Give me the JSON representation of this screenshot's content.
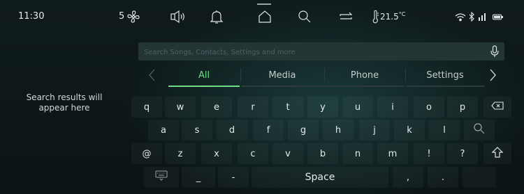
{
  "status_bar": {
    "time": "11:30",
    "fan_speed": "5",
    "temperature": "21.5",
    "temperature_unit": "°C",
    "icons": [
      "fan-icon",
      "volume-icon",
      "bell-icon",
      "home-icon",
      "search-icon",
      "repeat-icon",
      "thermometer-icon",
      "wifi-icon",
      "bluetooth-icon",
      "signal-icon",
      "battery-icon"
    ]
  },
  "search": {
    "placeholder": "Search Songs, Contacts, Settings and more",
    "value": "",
    "mic_icon": "microphone-icon"
  },
  "tabs": {
    "items": [
      {
        "label": "All",
        "active": true
      },
      {
        "label": "Media",
        "active": false
      },
      {
        "label": "Phone",
        "active": false
      },
      {
        "label": "Settings",
        "active": false
      }
    ],
    "accent_color": "#6fdc86"
  },
  "results_placeholder": "Search results will appear here",
  "keyboard": {
    "row1": [
      "q",
      "w",
      "e",
      "r",
      "t",
      "y",
      "u",
      "i",
      "o",
      "p"
    ],
    "row2": [
      "a",
      "s",
      "d",
      "f",
      "g",
      "h",
      "j",
      "k",
      "l"
    ],
    "row3": [
      "@",
      "z",
      "x",
      "c",
      "v",
      "b",
      "n",
      "m",
      "!",
      "?"
    ],
    "row4": {
      "underscore": "_",
      "dash": "-",
      "space": "Space",
      "comma": ",",
      "period": "."
    }
  }
}
